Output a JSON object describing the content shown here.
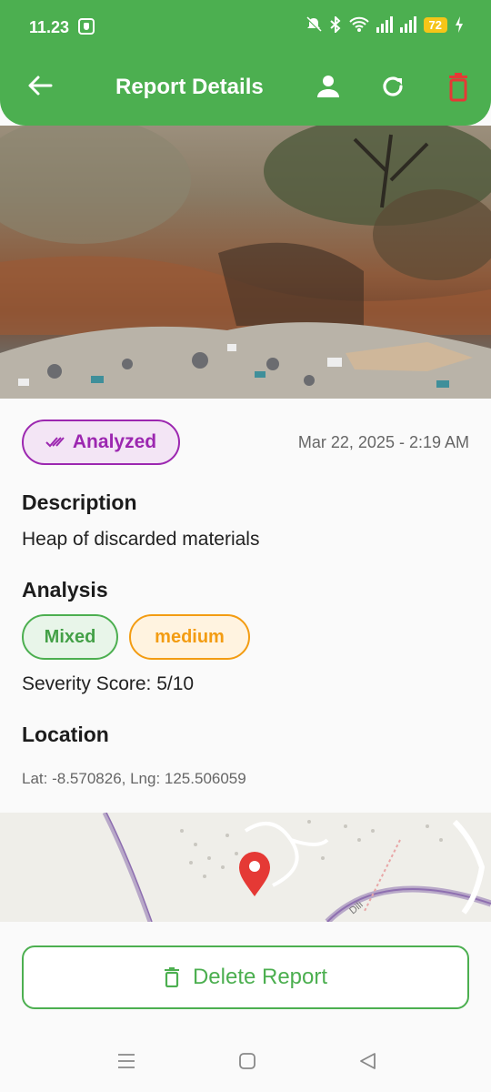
{
  "status_bar": {
    "time": "11.23",
    "battery": "72"
  },
  "app_bar": {
    "title": "Report Details"
  },
  "report": {
    "status": "Analyzed",
    "datetime": "Mar 22, 2025 - 2:19 AM",
    "description_heading": "Description",
    "description": "Heap of discarded materials",
    "analysis_heading": "Analysis",
    "waste_type": "Mixed",
    "severity_level": "medium",
    "severity_score": "Severity Score: 5/10",
    "location_heading": "Location",
    "coordinates": "Lat: -8.570826, Lng: 125.506059"
  },
  "map": {
    "road_label": "Dili"
  },
  "actions": {
    "delete_label": "Delete Report"
  },
  "colors": {
    "primary": "#4caf50",
    "analyzed": "#9c27b0",
    "medium": "#f39c12",
    "delete_icon": "#e53935",
    "map_pin": "#e53935"
  }
}
